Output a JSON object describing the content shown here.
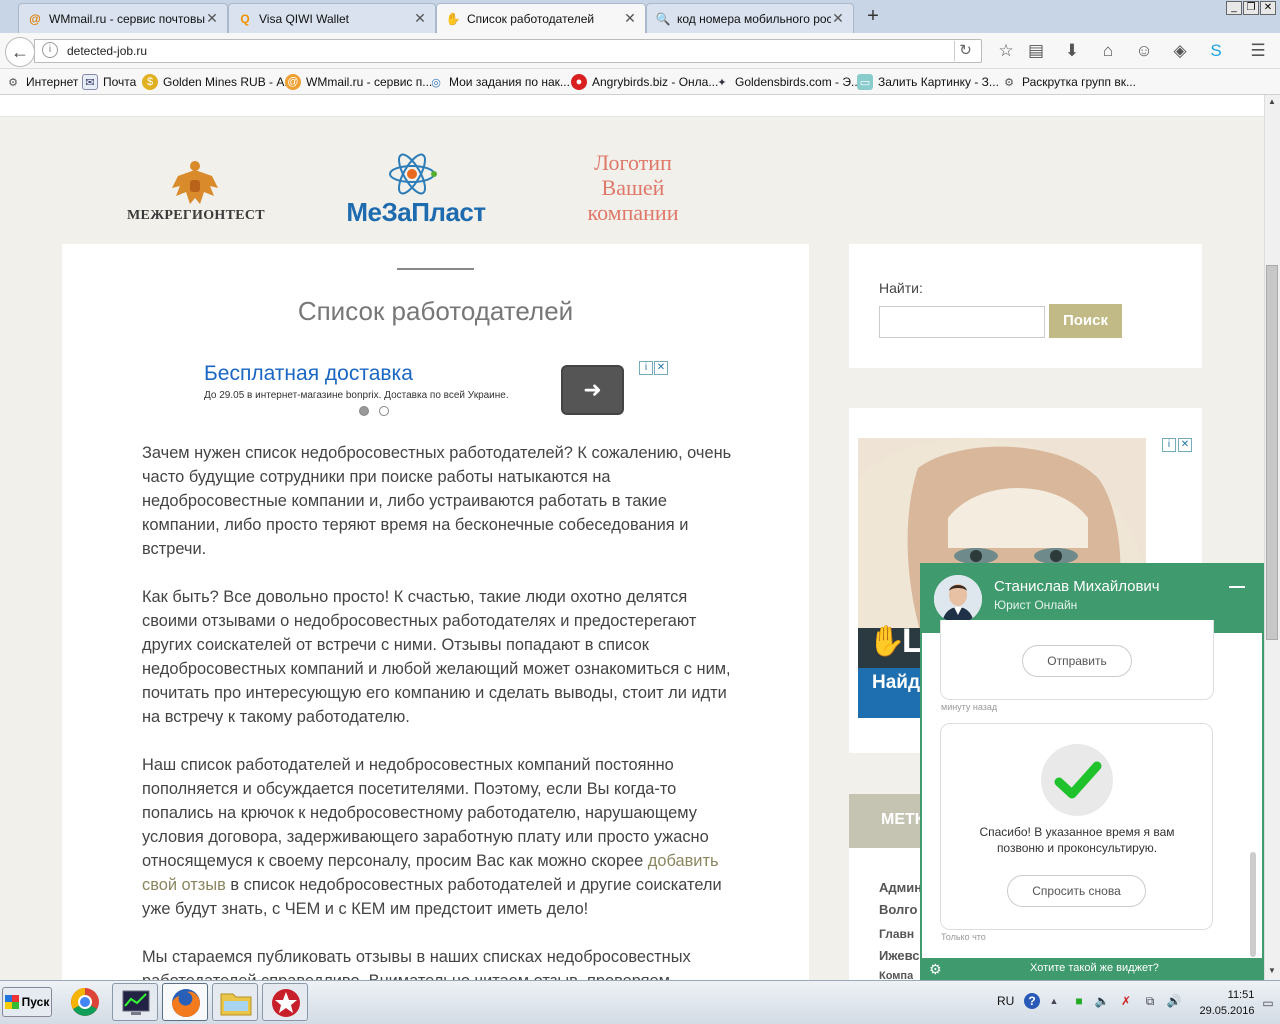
{
  "tabs": [
    {
      "title": "WMmail.ru - сервис почтовы...",
      "icon": "wmmail-icon",
      "active": false
    },
    {
      "title": "Visa QIWI Wallet",
      "icon": "qiwi-icon",
      "active": false
    },
    {
      "title": "Список работодателей",
      "icon": "hand-icon",
      "active": true
    },
    {
      "title": "код номера мобильного рос...",
      "icon": "search-icon",
      "active": false
    }
  ],
  "url": "detected-job.ru",
  "bookmarks": [
    "Интернет",
    "Почта",
    "Golden Mines RUB - А...",
    "WMmail.ru - сервис п...",
    "Мои задания по нак...",
    "Angrybirds.biz - Онла...",
    "Goldensbirds.com - Э...",
    "Залить Картинку - З...",
    "Раскрутка групп вк..."
  ],
  "logos": {
    "logo1": "МЕЖРЕГИОНТЕСТ",
    "logo2": "МеЗаПласт",
    "logo3_line1": "Логотип",
    "logo3_line2": "Вашей",
    "logo3_line3": "компании"
  },
  "main": {
    "title": "Список работодателей",
    "ad": {
      "title": "Бесплатная доставка",
      "desc": "До 29.05 в интернет-магазине bonprix. Доставка по всей Украине."
    },
    "p1": "Зачем нужен список недобросовестных работодателей? К сожалению, очень часто будущие сотрудники при поиске работы натыкаются на недобросовестные компании и, либо устраиваются работать в такие компании, либо просто теряют время на бесконечные собеседования и встречи.",
    "p2": "Как быть? Все довольно просто! К счастью, такие люди охотно делятся своими отзывами о недобросовестных работодателях и предостерегают других соискателей от встречи с ними. Отзывы попадают в список недобросовестных компаний и любой желающий может ознакомиться с ним, почитать про интересующую его компанию и сделать выводы, стоит ли идти на встречу к такому работодателю.",
    "p3_before": "Наш список работодателей и недобросовестных компаний постоянно пополняется и обсуждается посетителями. Поэтому, если Вы когда-то попались на крючок к недобросовестному работодателю, нарушающему условия договора, задерживающего заработную плату или просто ужасно относящемуся к своему персоналу, просим Вас как можно скорее ",
    "p3_link": "добавить свой отзыв",
    "p3_after": " в список недобросовестных работодателей и другие соискатели уже будут знать, с ЧЕМ и с КЕМ им предстоит иметь дело!",
    "p4": "Мы стараемся публиковать отзывы в наших списках недобросовестных работодателей справедливо. Внимательно читаем отзыв, проверяем"
  },
  "sidebar": {
    "search_label": "Найти:",
    "search_value": "",
    "search_button": "Поиск",
    "ad_text1": "L",
    "ad_text2": "Найд",
    "met_label": "МЕТК",
    "links": [
      "Админ",
      "Волго",
      "Главн",
      "Ижевс",
      "Компа"
    ]
  },
  "chat": {
    "name": "Станислав Михайлович",
    "role": "Юрист Онлайн",
    "send_button": "Отправить",
    "time1": "минуту назад",
    "thanks": "Спасибо! В указанное время я вам позвоню и проконсультирую.",
    "ask_again": "Спросить снова",
    "time2": "Только что",
    "footer": "Хотите такой же виджет?"
  },
  "taskbar": {
    "start": "Пуск",
    "lang": "RU",
    "time": "11:51",
    "date": "29.05.2016"
  },
  "colors": {
    "accent_green": "#3f9a6e",
    "search_button": "#c2ba86",
    "link": "#8a8660",
    "ad_title": "#1a66c3"
  }
}
